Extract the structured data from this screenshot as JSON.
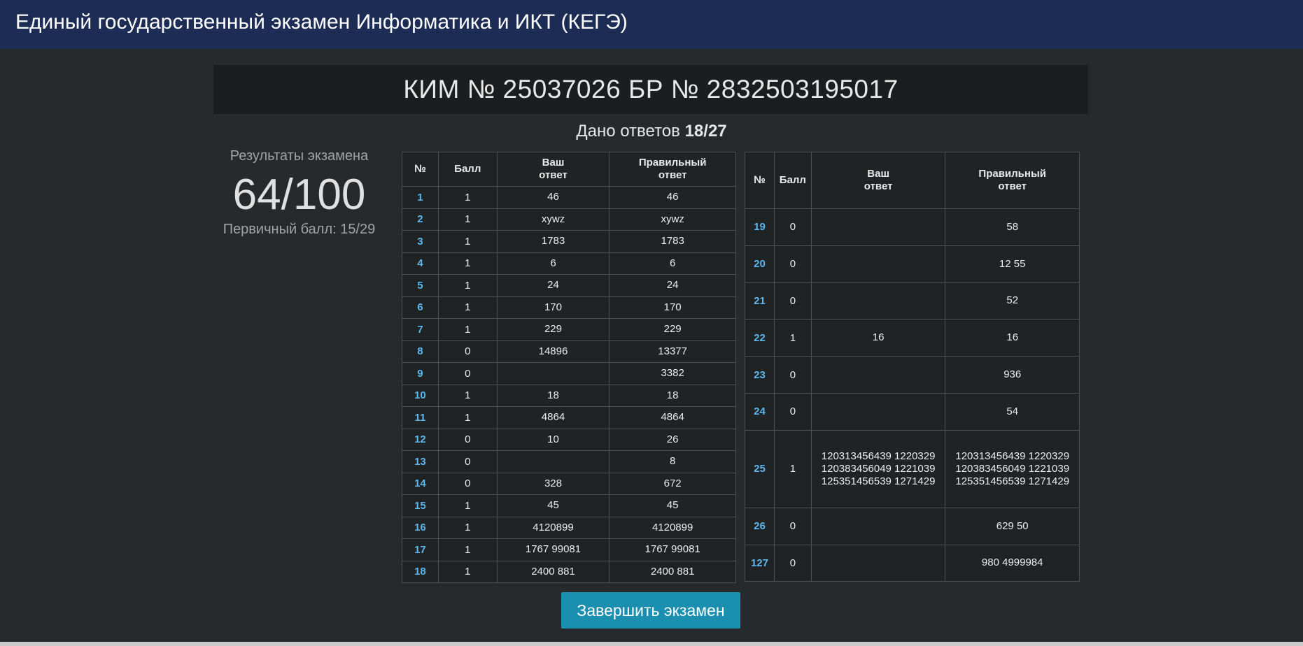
{
  "header": {
    "title": "Единый государственный экзамен Информатика и ИКТ (КЕГЭ)"
  },
  "kim": {
    "title": "КИМ № 25037026 БР № 2832503195017"
  },
  "answered": {
    "label": "Дано ответов",
    "value": "18/27"
  },
  "results": {
    "label": "Результаты экзамена",
    "score": "64/100",
    "primary": "Первичный балл: 15/29"
  },
  "table_headers": {
    "num": "№",
    "score": "Балл",
    "your_answer": "Ваш\nответ",
    "correct_answer": "Правильный\nответ"
  },
  "left_rows": [
    {
      "num": "1",
      "score": "1",
      "yours": "46",
      "correct": "46"
    },
    {
      "num": "2",
      "score": "1",
      "yours": "xywz",
      "correct": "xywz"
    },
    {
      "num": "3",
      "score": "1",
      "yours": "1783",
      "correct": "1783"
    },
    {
      "num": "4",
      "score": "1",
      "yours": "6",
      "correct": "6"
    },
    {
      "num": "5",
      "score": "1",
      "yours": "24",
      "correct": "24"
    },
    {
      "num": "6",
      "score": "1",
      "yours": "170",
      "correct": "170"
    },
    {
      "num": "7",
      "score": "1",
      "yours": "229",
      "correct": "229"
    },
    {
      "num": "8",
      "score": "0",
      "yours": "14896",
      "correct": "13377"
    },
    {
      "num": "9",
      "score": "0",
      "yours": "",
      "correct": "3382"
    },
    {
      "num": "10",
      "score": "1",
      "yours": "18",
      "correct": "18"
    },
    {
      "num": "11",
      "score": "1",
      "yours": "4864",
      "correct": "4864"
    },
    {
      "num": "12",
      "score": "0",
      "yours": "10",
      "correct": "26"
    },
    {
      "num": "13",
      "score": "0",
      "yours": "",
      "correct": "8"
    },
    {
      "num": "14",
      "score": "0",
      "yours": "328",
      "correct": "672"
    },
    {
      "num": "15",
      "score": "1",
      "yours": "45",
      "correct": "45"
    },
    {
      "num": "16",
      "score": "1",
      "yours": "4120899",
      "correct": "4120899"
    },
    {
      "num": "17",
      "score": "1",
      "yours": "1767 99081",
      "correct": "1767 99081"
    },
    {
      "num": "18",
      "score": "1",
      "yours": "2400 881",
      "correct": "2400 881"
    }
  ],
  "right_rows": [
    {
      "num": "19",
      "score": "0",
      "yours": "",
      "correct": "58"
    },
    {
      "num": "20",
      "score": "0",
      "yours": "",
      "correct": "12 55"
    },
    {
      "num": "21",
      "score": "0",
      "yours": "",
      "correct": "52"
    },
    {
      "num": "22",
      "score": "1",
      "yours": "16",
      "correct": "16"
    },
    {
      "num": "23",
      "score": "0",
      "yours": "",
      "correct": "936"
    },
    {
      "num": "24",
      "score": "0",
      "yours": "",
      "correct": "54"
    },
    {
      "num": "25",
      "score": "1",
      "yours": "120313456439 1220329\n120383456049 1221039\n125351456539 1271429",
      "correct": "120313456439 1220329\n120383456049 1221039\n125351456539 1271429"
    },
    {
      "num": "26",
      "score": "0",
      "yours": "",
      "correct": "629 50"
    },
    {
      "num": "127",
      "score": "0",
      "yours": "",
      "correct": "980 4999984"
    }
  ],
  "finish_button": {
    "label": "Завершить экзамен"
  },
  "colors": {
    "topbar": "#1c2c55",
    "background": "#262a2c",
    "banner": "#1b1d1e",
    "task_number": "#5bb8f0",
    "button": "#1a8fb0"
  }
}
